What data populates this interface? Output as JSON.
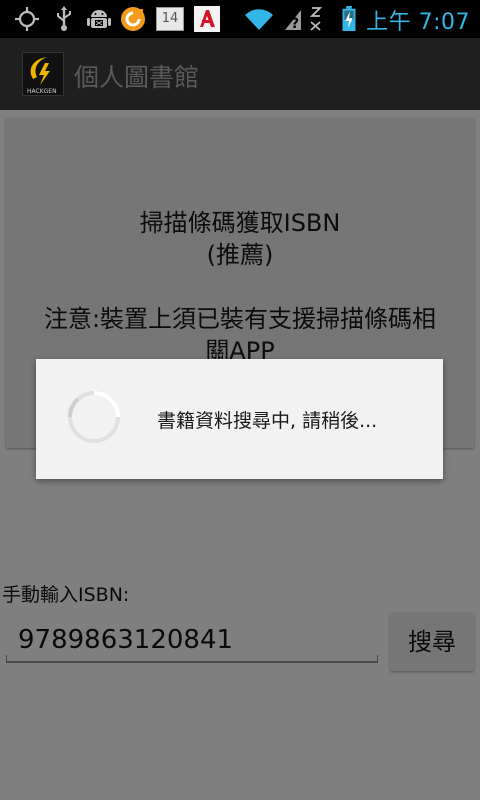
{
  "status_bar": {
    "time": "上午 7:07",
    "calendar_day": "14",
    "icons": [
      "gps-icon",
      "usb-icon",
      "android-debug-icon",
      "sync-icon",
      "calendar-icon",
      "app-notification-icon",
      "wifi-icon",
      "signal-unknown-icon",
      "data-off-icon",
      "battery-charging-icon"
    ]
  },
  "action_bar": {
    "title": "個人圖書館",
    "logo_text": "HACKGEN"
  },
  "scan_button": {
    "line1": "掃描條碼獲取ISBN",
    "line2": "(推薦)",
    "line3": "注意:裝置上須已裝有支援掃描條碼相",
    "line4": "關APP"
  },
  "manual": {
    "label": "手動輸入ISBN:",
    "isbn_value": "9789863120841",
    "search_label": "搜尋"
  },
  "dialog": {
    "message": "書籍資料搜尋中, 請稍後..."
  },
  "colors": {
    "accent": "#33b5e5",
    "dim_background": "#7f7f7f",
    "dialog_bg": "#f2f2f2"
  }
}
